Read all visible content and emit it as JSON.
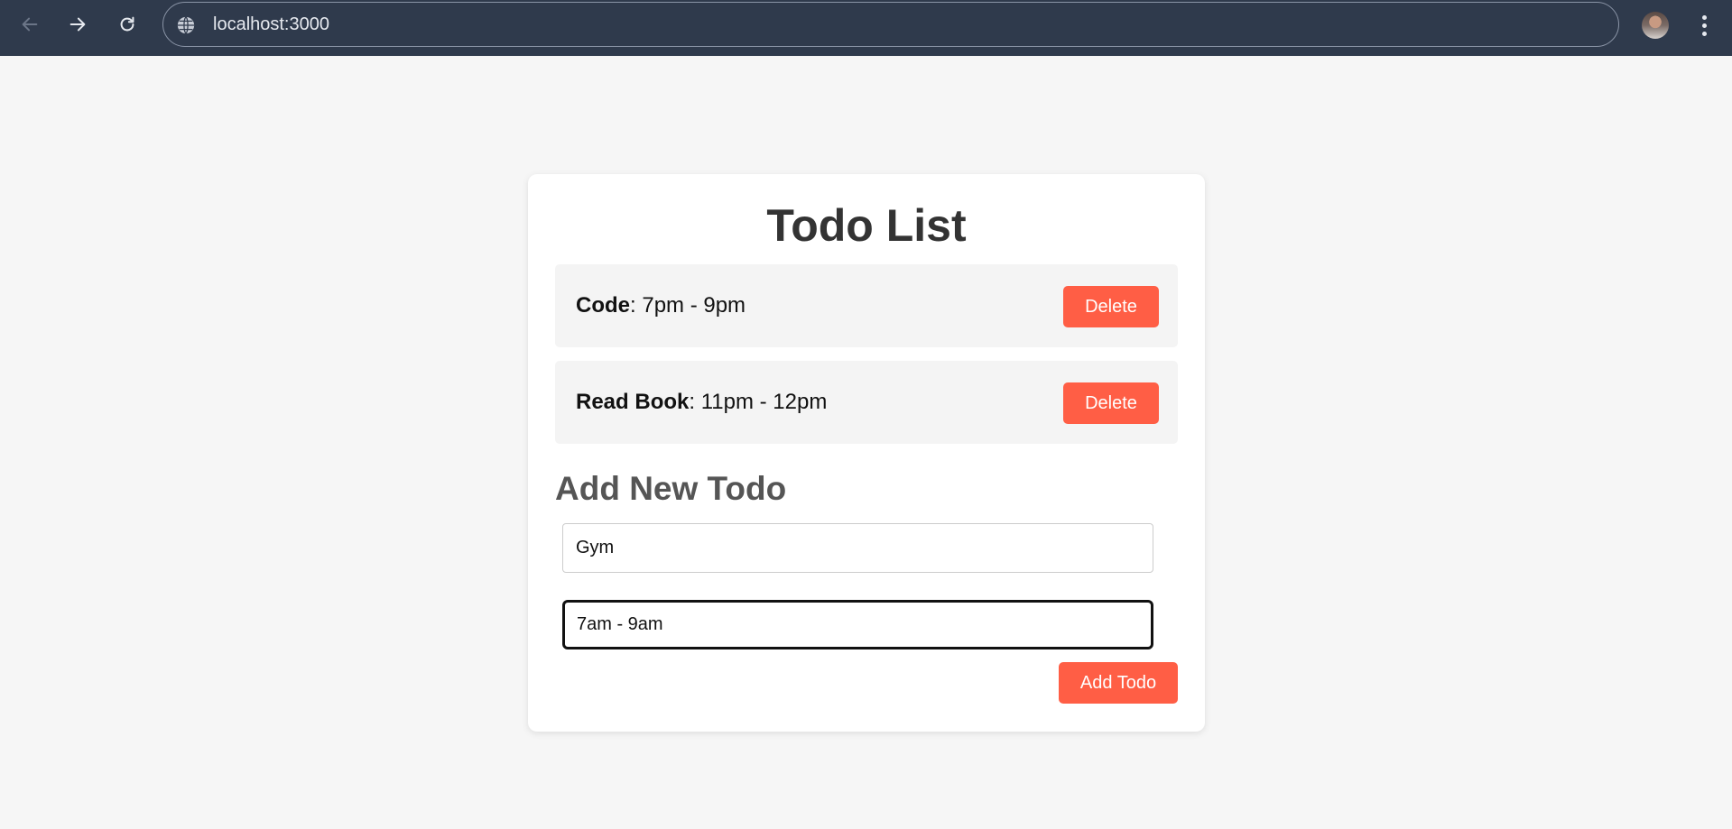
{
  "browser": {
    "url": "localhost:3000",
    "icons": {
      "back": "arrow-left-icon",
      "forward": "arrow-right-icon",
      "reload": "reload-icon",
      "site": "globe-icon",
      "menu": "more-vertical-icon"
    },
    "colors": {
      "toolbar": "#2f3a4c",
      "text": "#e6e9ef"
    }
  },
  "app": {
    "title": "Todo List",
    "todos": [
      {
        "name": "Code",
        "separator": ":",
        "time": " 7pm - 9pm",
        "delete_label": "Delete"
      },
      {
        "name": "Read Book",
        "separator": ":",
        "time": " 11pm - 12pm",
        "delete_label": "Delete"
      }
    ],
    "form": {
      "heading": "Add New Todo",
      "name_value": "Gym",
      "time_value": "7am - 9am",
      "submit_label": "Add Todo"
    },
    "colors": {
      "accent": "#ff5e45",
      "title": "#333333",
      "heading": "#555555",
      "background": "#f6f6f6"
    }
  }
}
